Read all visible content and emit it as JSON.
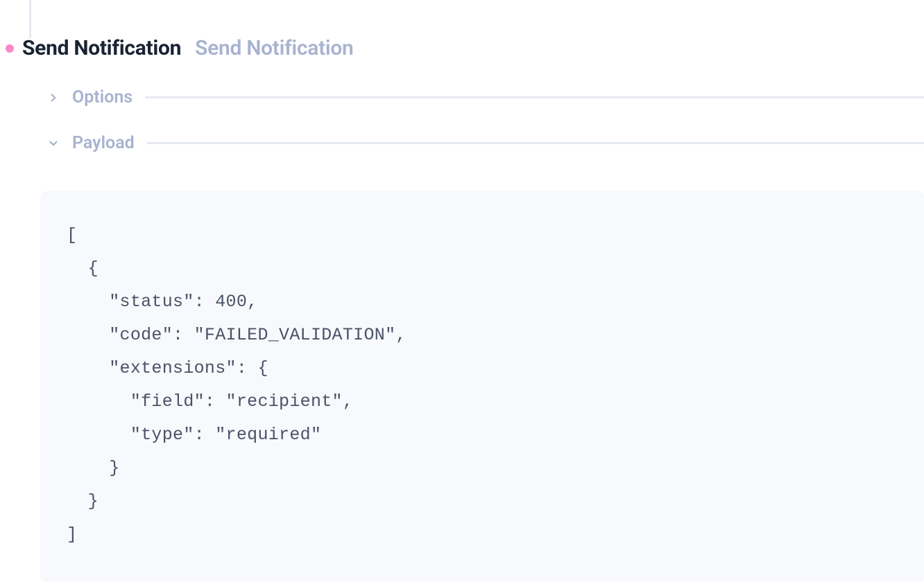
{
  "header": {
    "title_primary": "Send Notification",
    "title_secondary": "Send Notification"
  },
  "sections": {
    "options": {
      "label": "Options",
      "expanded": false
    },
    "payload": {
      "label": "Payload",
      "expanded": true
    }
  },
  "payload_code": "[\n  {\n    \"status\": 400,\n    \"code\": \"FAILED_VALIDATION\",\n    \"extensions\": {\n      \"field\": \"recipient\",\n      \"type\": \"required\"\n    }\n  }\n]"
}
